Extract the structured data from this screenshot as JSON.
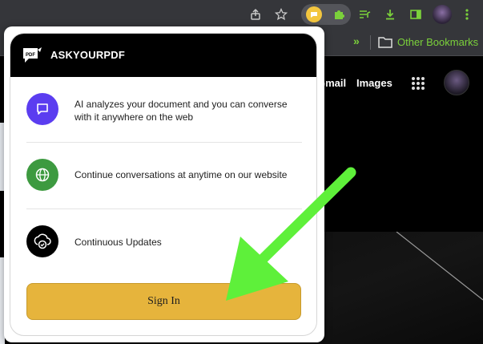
{
  "bookmarks": {
    "other_label": "Other Bookmarks"
  },
  "google": {
    "gmail": "Gmail",
    "images": "Images"
  },
  "popup": {
    "brand": "ASKYOURPDF",
    "features": [
      {
        "icon": "chat-icon",
        "color": "#5b3df0",
        "text": "AI analyzes your document and you can converse with it anywhere on the web"
      },
      {
        "icon": "globe-icon",
        "color": "#3d9a40",
        "text": "Continue conversations at anytime on our website"
      },
      {
        "icon": "cloud-check-icon",
        "color": "#000000",
        "text": "Continuous Updates"
      }
    ],
    "sign_in": "Sign In",
    "sign_in_color": "#e6b43c"
  },
  "annotation": {
    "arrow_color": "#5ef03a"
  }
}
